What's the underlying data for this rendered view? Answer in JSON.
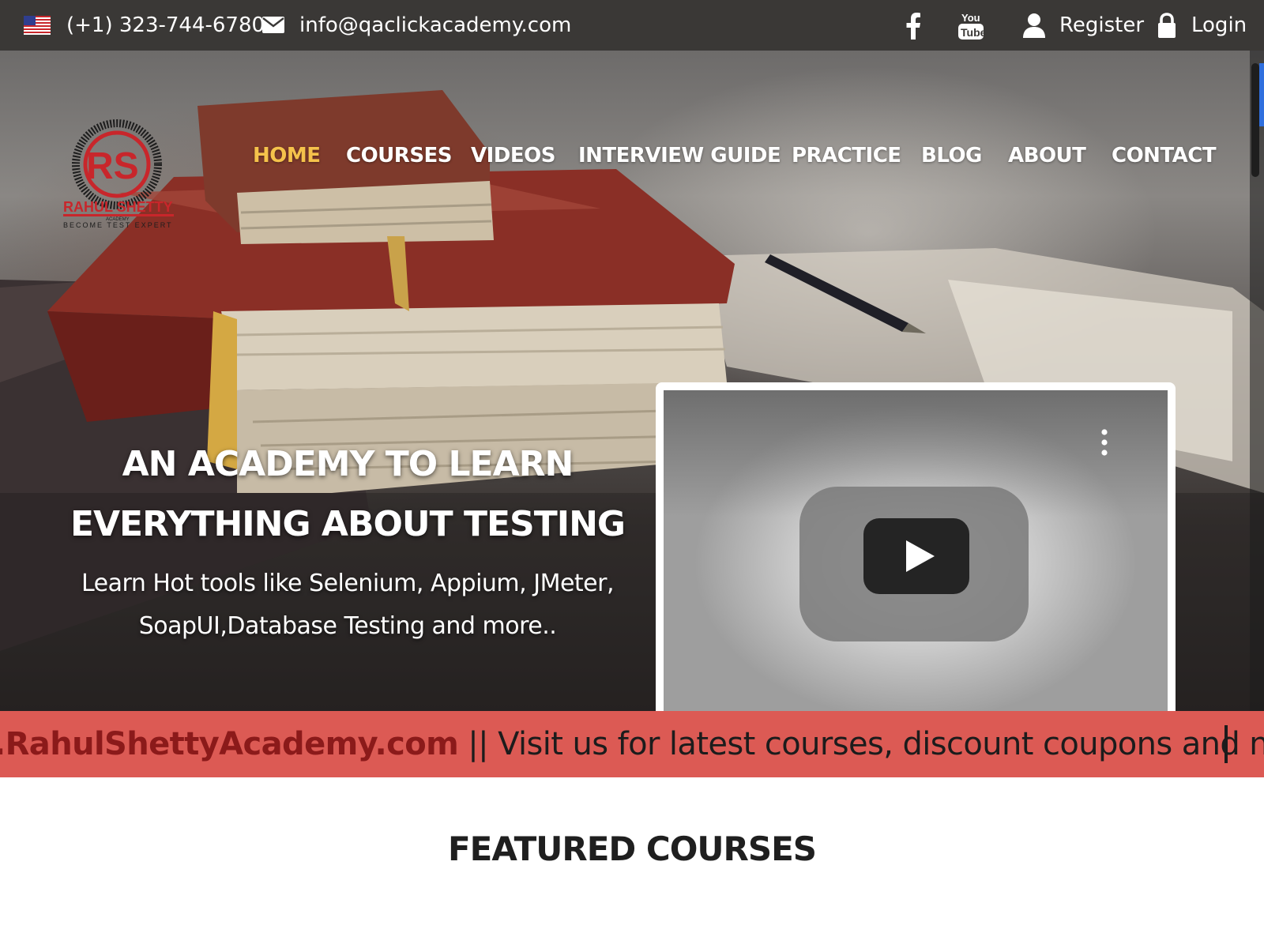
{
  "topbar": {
    "phone": "(+1) 323-744-6780",
    "email": "info@qaclickacademy.com",
    "register_label": "Register",
    "login_label": "Login",
    "icons": [
      "us-flag-icon",
      "envelope-icon",
      "facebook-icon",
      "youtube-icon",
      "user-icon",
      "lock-icon"
    ]
  },
  "logo": {
    "monogram": "RS",
    "name": "RAHUL SHETTY",
    "sub": "ACADEMY",
    "tagline": "BECOME TEST EXPERT"
  },
  "nav": {
    "items": [
      {
        "label": "HOME",
        "active": true
      },
      {
        "label": "COURSES",
        "active": false
      },
      {
        "label": "VIDEOS",
        "active": false
      },
      {
        "label": "INTERVIEW GUIDE",
        "active": false
      },
      {
        "label": "PRACTICE",
        "active": false
      },
      {
        "label": "BLOG",
        "active": false
      },
      {
        "label": "ABOUT",
        "active": false
      },
      {
        "label": "CONTACT",
        "active": false
      }
    ]
  },
  "hero": {
    "headline_line1": "AN ACADEMY TO LEARN",
    "headline_line2": "EVERYTHING ABOUT TESTING",
    "sub_line1": "Learn Hot tools like Selenium, Appium, JMeter,",
    "sub_line2": "SoapUI,Database Testing and more..",
    "video": {
      "icons": [
        "youtube-play-icon",
        "more-vert-icon"
      ]
    }
  },
  "marquee": {
    "link_text": ".RahulShettyAcademy.com",
    "message": " || Visit us for latest courses, discount coupons and new practice"
  },
  "featured": {
    "title": "FEATURED COURSES"
  },
  "colors": {
    "topbar_bg": "#3a3836",
    "nav_active": "#f5c24b",
    "marquee_bg": "#dc5a54",
    "brand_red": "#c8262b"
  }
}
